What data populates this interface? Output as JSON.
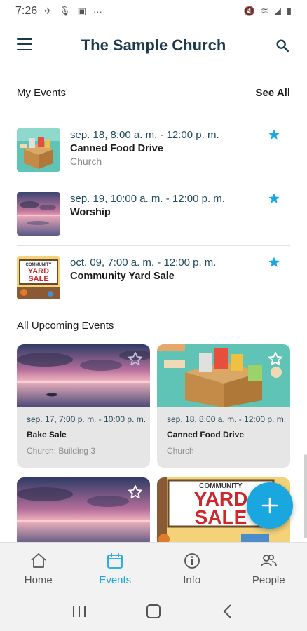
{
  "status_bar": {
    "time": "7:26",
    "extra": "···"
  },
  "app_bar": {
    "title": "The Sample Church"
  },
  "my_events": {
    "heading": "My Events",
    "see_all": "See All",
    "items": [
      {
        "date": "sep. 18, 8:00 a. m. - 12:00 p. m.",
        "name": "Canned Food Drive",
        "place": "Church"
      },
      {
        "date": "sep. 19, 10:00 a. m. - 12:00 p. m.",
        "name": "Worship",
        "place": ""
      },
      {
        "date": "oct. 09, 7:00 a. m. - 12:00 p. m.",
        "name": "Community Yard Sale",
        "place": ""
      }
    ]
  },
  "upcoming": {
    "heading": "All Upcoming Events",
    "cards": [
      {
        "date": "sep. 17, 7:00 p. m. - 10:00 p. m.",
        "name": "Bake Sale",
        "place": "Church: Building 3"
      },
      {
        "date": "sep. 18, 8:00 a. m. - 12:00 p. m.",
        "name": "Canned Food Drive",
        "place": "Church"
      }
    ]
  },
  "yard_sale_art": {
    "top": "COMMUNITY",
    "line1": "YARD",
    "line2": "SALE"
  },
  "bottom_nav": {
    "items": [
      {
        "label": "Home",
        "icon": "home-icon"
      },
      {
        "label": "Events",
        "icon": "calendar-icon"
      },
      {
        "label": "Info",
        "icon": "info-icon"
      },
      {
        "label": "People",
        "icon": "people-icon"
      }
    ],
    "active": "Events"
  },
  "colors": {
    "accent": "#1aa7e0",
    "title": "#1d3b4c",
    "card_bg": "#e6e6e6"
  }
}
